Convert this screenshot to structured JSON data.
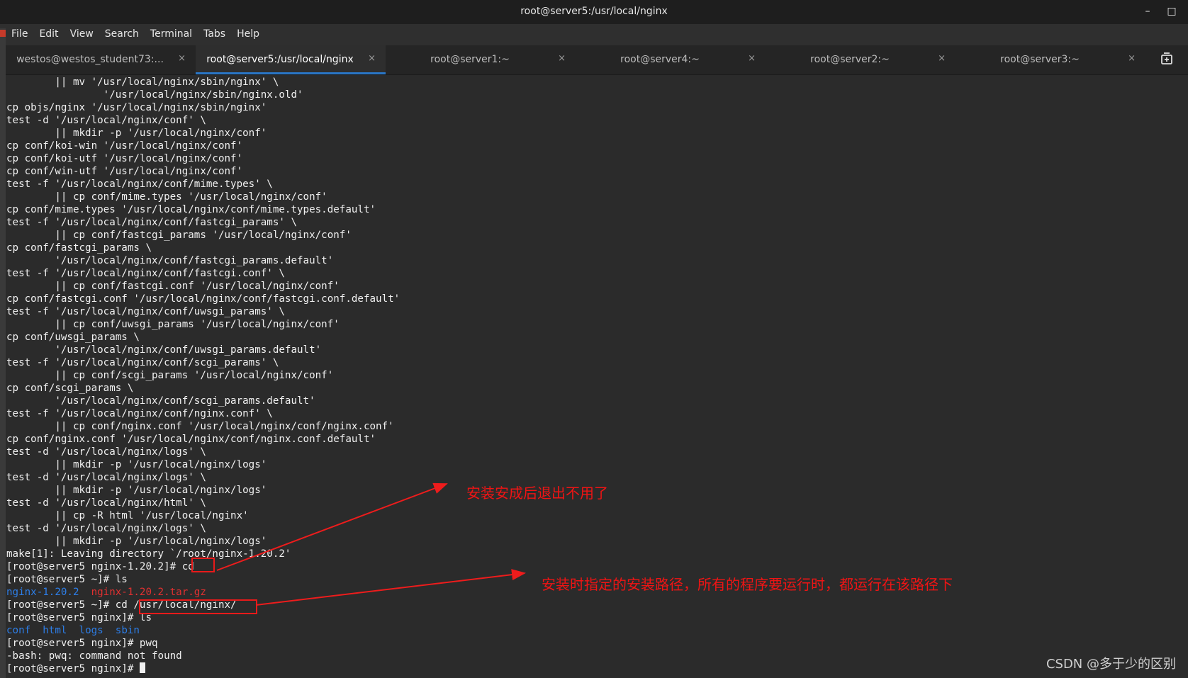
{
  "window": {
    "title": "root@server5:/usr/local/nginx",
    "minimize_glyph": "–",
    "maximize_glyph": "□"
  },
  "menu": [
    "File",
    "Edit",
    "View",
    "Search",
    "Terminal",
    "Tabs",
    "Help"
  ],
  "tabs": [
    {
      "label": "westos@westos_student73:...",
      "active": false
    },
    {
      "label": "root@server5:/usr/local/nginx",
      "active": true
    },
    {
      "label": "root@server1:~",
      "active": false
    },
    {
      "label": "root@server4:~",
      "active": false
    },
    {
      "label": "root@server2:~",
      "active": false
    },
    {
      "label": "root@server3:~",
      "active": false
    }
  ],
  "tab_close_glyph": "×",
  "icons": {
    "new_tab": "new-tab-icon"
  },
  "colors": {
    "accent": "#2a76c6",
    "annotation": "#f01414",
    "dir_blue": "#2d7ee8",
    "archive_red": "#e03030",
    "terminal_bg": "#2b2b2b"
  },
  "terminal": {
    "lines": [
      {
        "t": "        || mv '/usr/local/nginx/sbin/nginx' \\"
      },
      {
        "t": "                '/usr/local/nginx/sbin/nginx.old'"
      },
      {
        "t": "cp objs/nginx '/usr/local/nginx/sbin/nginx'"
      },
      {
        "t": "test -d '/usr/local/nginx/conf' \\"
      },
      {
        "t": "        || mkdir -p '/usr/local/nginx/conf'"
      },
      {
        "t": "cp conf/koi-win '/usr/local/nginx/conf'"
      },
      {
        "t": "cp conf/koi-utf '/usr/local/nginx/conf'"
      },
      {
        "t": "cp conf/win-utf '/usr/local/nginx/conf'"
      },
      {
        "t": "test -f '/usr/local/nginx/conf/mime.types' \\"
      },
      {
        "t": "        || cp conf/mime.types '/usr/local/nginx/conf'"
      },
      {
        "t": "cp conf/mime.types '/usr/local/nginx/conf/mime.types.default'"
      },
      {
        "t": "test -f '/usr/local/nginx/conf/fastcgi_params' \\"
      },
      {
        "t": "        || cp conf/fastcgi_params '/usr/local/nginx/conf'"
      },
      {
        "t": "cp conf/fastcgi_params \\"
      },
      {
        "t": "        '/usr/local/nginx/conf/fastcgi_params.default'"
      },
      {
        "t": "test -f '/usr/local/nginx/conf/fastcgi.conf' \\"
      },
      {
        "t": "        || cp conf/fastcgi.conf '/usr/local/nginx/conf'"
      },
      {
        "t": "cp conf/fastcgi.conf '/usr/local/nginx/conf/fastcgi.conf.default'"
      },
      {
        "t": "test -f '/usr/local/nginx/conf/uwsgi_params' \\"
      },
      {
        "t": "        || cp conf/uwsgi_params '/usr/local/nginx/conf'"
      },
      {
        "t": "cp conf/uwsgi_params \\"
      },
      {
        "t": "        '/usr/local/nginx/conf/uwsgi_params.default'"
      },
      {
        "t": "test -f '/usr/local/nginx/conf/scgi_params' \\"
      },
      {
        "t": "        || cp conf/scgi_params '/usr/local/nginx/conf'"
      },
      {
        "t": "cp conf/scgi_params \\"
      },
      {
        "t": "        '/usr/local/nginx/conf/scgi_params.default'"
      },
      {
        "t": "test -f '/usr/local/nginx/conf/nginx.conf' \\"
      },
      {
        "t": "        || cp conf/nginx.conf '/usr/local/nginx/conf/nginx.conf'"
      },
      {
        "t": "cp conf/nginx.conf '/usr/local/nginx/conf/nginx.conf.default'"
      },
      {
        "t": "test -d '/usr/local/nginx/logs' \\"
      },
      {
        "t": "        || mkdir -p '/usr/local/nginx/logs'"
      },
      {
        "t": "test -d '/usr/local/nginx/logs' \\"
      },
      {
        "t": "        || mkdir -p '/usr/local/nginx/logs'"
      },
      {
        "t": "test -d '/usr/local/nginx/html' \\"
      },
      {
        "t": "        || cp -R html '/usr/local/nginx'"
      },
      {
        "t": "test -d '/usr/local/nginx/logs' \\"
      },
      {
        "t": "        || mkdir -p '/usr/local/nginx/logs'"
      },
      {
        "t": "make[1]: Leaving directory `/root/nginx-1.20.2'"
      },
      {
        "t": "[root@server5 nginx-1.20.2]# cd"
      },
      {
        "t": "[root@server5 ~]# ls"
      },
      {
        "segs": [
          {
            "t": "nginx-1.20.2",
            "c": "blue"
          },
          {
            "t": "  "
          },
          {
            "t": "nginx-1.20.2.tar.gz",
            "c": "red"
          }
        ]
      },
      {
        "t": "[root@server5 ~]# cd /usr/local/nginx/"
      },
      {
        "t": "[root@server5 nginx]# ls"
      },
      {
        "segs": [
          {
            "t": "conf",
            "c": "blue"
          },
          {
            "t": "  "
          },
          {
            "t": "html",
            "c": "blue"
          },
          {
            "t": "  "
          },
          {
            "t": "logs",
            "c": "blue"
          },
          {
            "t": "  "
          },
          {
            "t": "sbin",
            "c": "blue"
          }
        ]
      },
      {
        "t": "[root@server5 nginx]# pwq"
      },
      {
        "t": "-bash: pwq: command not found"
      },
      {
        "t": "[root@server5 nginx]# ",
        "cursor": true
      }
    ]
  },
  "annotations": {
    "note1": "安装安成后退出不用了",
    "note2": "安装时指定的安装路径，所有的程序要运行时，都运行在该路径下"
  },
  "watermark": "CSDN @多于少的区别"
}
